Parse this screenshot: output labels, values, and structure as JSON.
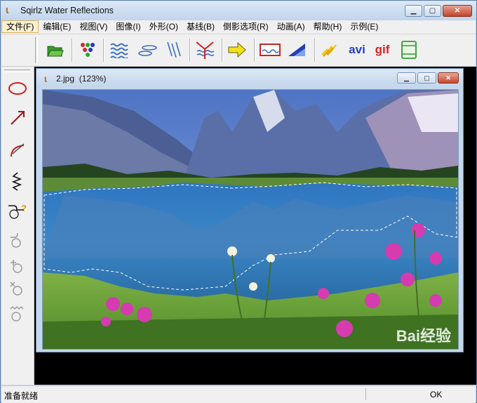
{
  "window": {
    "title": "Sqirlz Water Reflections",
    "minimize": "0",
    "maximize": "1",
    "close": "r"
  },
  "menu": [
    "文件(F)",
    "编辑(E)",
    "视图(V)",
    "图像(I)",
    "外形(O)",
    "基线(B)",
    "倒影选项(R)",
    "动画(A)",
    "帮助(H)",
    "示例(E)"
  ],
  "toolbar": {
    "avi_label": "avi",
    "gif_label": "gif"
  },
  "icons": {
    "open": "folder-open-icon",
    "dots": "color-dots-icon",
    "waves": "waves-icon",
    "ripples": "ripples-icon",
    "rain": "rain-icon",
    "funnel": "funnel-icon",
    "arrow": "yellow-arrow-icon",
    "preview": "preview-frame-icon",
    "triangle": "triangle-icon",
    "flash": "flash-icon",
    "panel": "panel-icon"
  },
  "child": {
    "title": "2.jpg",
    "zoom": "(123%)"
  },
  "status": {
    "left": "准备就绪",
    "right": "OK"
  },
  "watermark": "Bai经验",
  "colors": {
    "accent": "#3a6fc4",
    "red_tool": "#cc1f1f",
    "close": "#c5472f"
  }
}
